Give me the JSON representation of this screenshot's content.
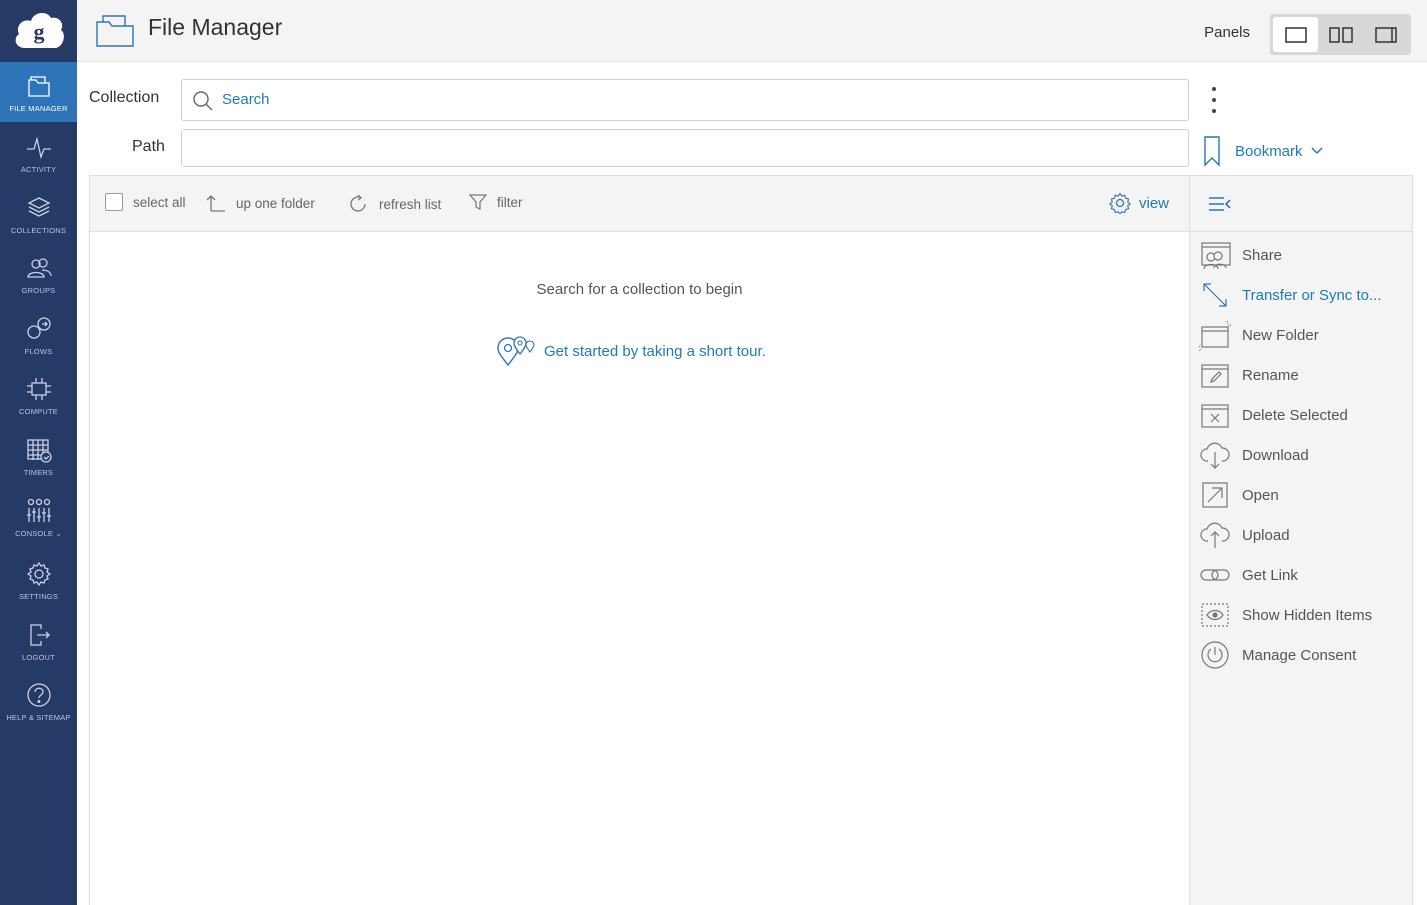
{
  "app": {
    "title": "File Manager",
    "accent_color": "#2e74b8",
    "sidebar_color": "#263a66",
    "link_color": "#1f7ab8"
  },
  "sidebar": {
    "items": [
      {
        "label": "FILE MANAGER",
        "icon": "folder-icon",
        "active": true
      },
      {
        "label": "ACTIVITY",
        "icon": "activity-icon"
      },
      {
        "label": "COLLECTIONS",
        "icon": "layers-icon"
      },
      {
        "label": "GROUPS",
        "icon": "people-icon"
      },
      {
        "label": "FLOWS",
        "icon": "flows-icon"
      },
      {
        "label": "COMPUTE",
        "icon": "compute-icon"
      },
      {
        "label": "TIMERS",
        "icon": "calendar-icon"
      },
      {
        "label": "CONSOLE",
        "icon": "sliders-icon"
      },
      {
        "label": "SETTINGS",
        "icon": "gear-icon"
      },
      {
        "label": "LOGOUT",
        "icon": "logout-icon"
      },
      {
        "label": "HELP & SITEMAP",
        "icon": "help-icon"
      }
    ]
  },
  "header": {
    "panels_label": "Panels",
    "panel_modes": [
      "single",
      "double",
      "right"
    ],
    "active_panel_mode": "single"
  },
  "collection": {
    "label": "Collection",
    "search_placeholder": "Search",
    "path_label": "Path",
    "path_value": "",
    "bookmark_label": "Bookmark"
  },
  "toolbar": {
    "select_all": "select all",
    "up_one_folder": "up one folder",
    "refresh_list": "refresh list",
    "filter": "filter",
    "view": "view"
  },
  "main": {
    "empty_message": "Search for a collection to begin",
    "tour_link": "Get started by taking a short tour."
  },
  "actions": [
    {
      "label": "Share",
      "icon": "share-icon"
    },
    {
      "label": "Transfer or Sync to...",
      "icon": "transfer-icon",
      "primary": true
    },
    {
      "label": "New Folder",
      "icon": "new-folder-icon"
    },
    {
      "label": "Rename",
      "icon": "rename-icon"
    },
    {
      "label": "Delete Selected",
      "icon": "delete-icon"
    },
    {
      "label": "Download",
      "icon": "download-icon"
    },
    {
      "label": "Open",
      "icon": "open-icon"
    },
    {
      "label": "Upload",
      "icon": "upload-icon"
    },
    {
      "label": "Get Link",
      "icon": "link-icon"
    },
    {
      "label": "Show Hidden Items",
      "icon": "eye-icon"
    },
    {
      "label": "Manage Consent",
      "icon": "power-icon"
    }
  ]
}
